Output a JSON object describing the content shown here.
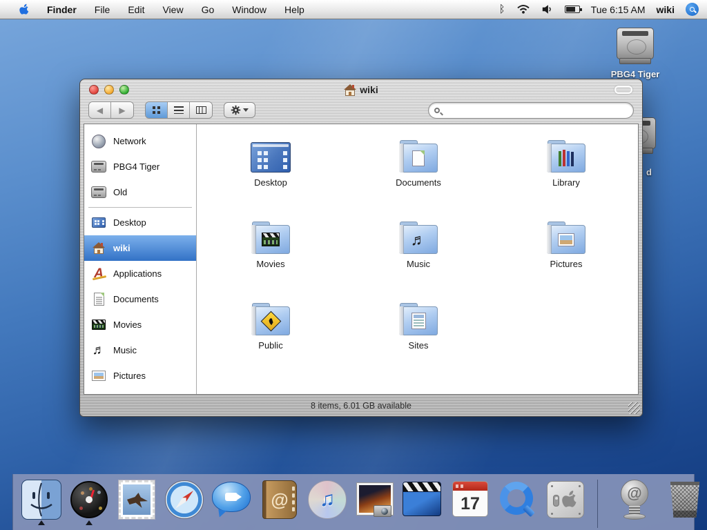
{
  "menu_bar": {
    "items": [
      "Finder",
      "File",
      "Edit",
      "View",
      "Go",
      "Window",
      "Help"
    ],
    "clock": "Tue 6:15 AM",
    "user": "wiki",
    "status_icons": [
      "bluetooth-icon",
      "wifi-icon",
      "volume-icon",
      "battery-icon",
      "spotlight-icon"
    ]
  },
  "desktop_icons": {
    "disk1_label": "PBG4 Tiger",
    "disk2_partial_label": "d"
  },
  "finder_window": {
    "title": "wiki",
    "search_placeholder": "",
    "status_text": "8 items, 6.01 GB available",
    "toolbar_icons": [
      "back-icon",
      "forward-icon",
      "icon-view",
      "list-view",
      "column-view",
      "action-gear"
    ],
    "sidebar": {
      "items": [
        {
          "label": "Network",
          "icon": "globe-icon"
        },
        {
          "label": "PBG4 Tiger",
          "icon": "hard-disk-icon"
        },
        {
          "label": "Old",
          "icon": "hard-disk-icon"
        },
        {
          "label": "Desktop",
          "icon": "desktop-icon"
        },
        {
          "label": "wiki",
          "icon": "home-icon",
          "selected": true
        },
        {
          "label": "Applications",
          "icon": "applications-icon"
        },
        {
          "label": "Documents",
          "icon": "document-icon"
        },
        {
          "label": "Movies",
          "icon": "clapperboard-icon"
        },
        {
          "label": "Music",
          "icon": "music-note-icon"
        },
        {
          "label": "Pictures",
          "icon": "picture-icon"
        }
      ]
    },
    "content": {
      "items": [
        {
          "label": "Desktop",
          "icon": "desktop-window-icon"
        },
        {
          "label": "Documents",
          "icon": "folder-document-icon"
        },
        {
          "label": "Library",
          "icon": "folder-books-icon"
        },
        {
          "label": "Movies",
          "icon": "folder-clapperboard-icon"
        },
        {
          "label": "Music",
          "icon": "folder-music-icon"
        },
        {
          "label": "Pictures",
          "icon": "folder-photo-icon"
        },
        {
          "label": "Public",
          "icon": "folder-crossing-sign-icon"
        },
        {
          "label": "Sites",
          "icon": "folder-webpage-icon"
        }
      ]
    }
  },
  "dock": {
    "items": [
      "finder",
      "dashboard",
      "mail",
      "safari",
      "ichat",
      "address-book",
      "itunes",
      "iphoto",
      "imovie",
      "ical",
      "quicktime",
      "system-preferences",
      "at-spring-shortcut",
      "trash"
    ],
    "running": [
      "finder",
      "dashboard"
    ],
    "ical_day": "17"
  },
  "colors": {
    "selection_blue": "#3272c6",
    "wallpaper_top": "#79a7dc",
    "wallpaper_bottom": "#123a7e",
    "dock_strip": "#8593b9"
  }
}
